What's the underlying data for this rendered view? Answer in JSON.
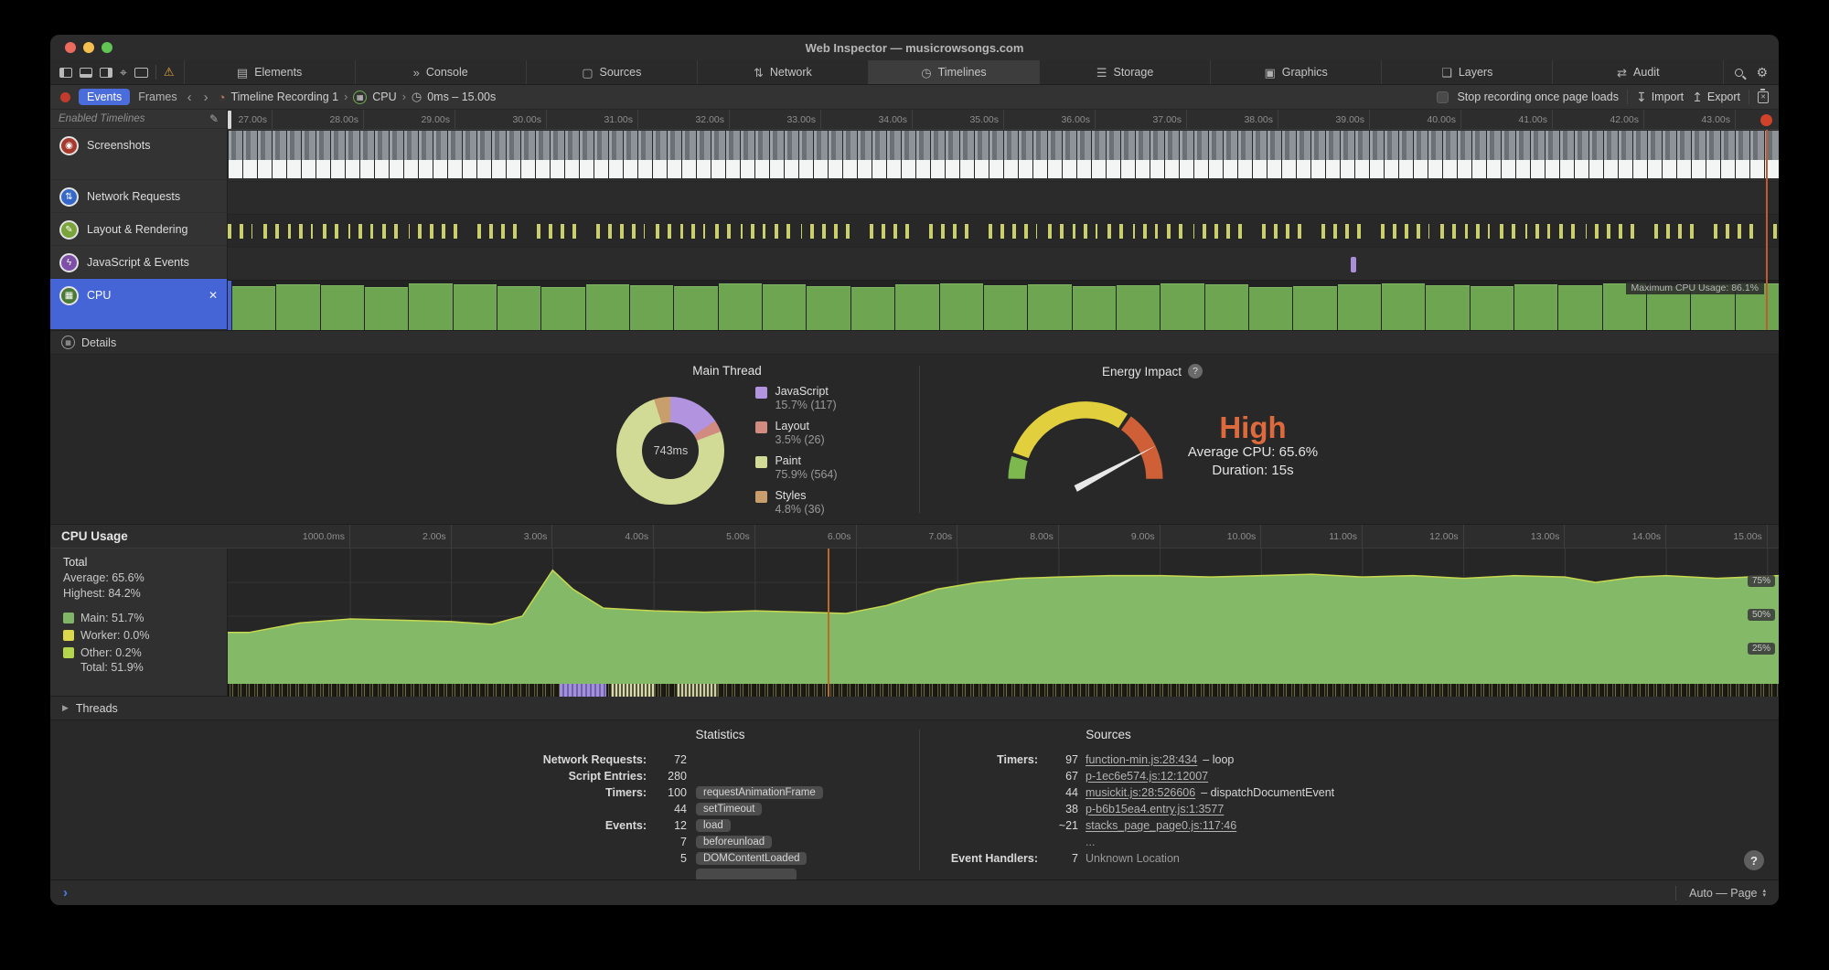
{
  "titlebar": {
    "title": "Web Inspector — musicrowsongs.com"
  },
  "tabbar": {
    "tabs": [
      {
        "label": "Elements",
        "icon": "elements-icon",
        "glyph": "▤",
        "selected": false
      },
      {
        "label": "Console",
        "icon": "console-icon",
        "glyph": "»",
        "selected": false
      },
      {
        "label": "Sources",
        "icon": "sources-icon",
        "glyph": "▢",
        "selected": false
      },
      {
        "label": "Network",
        "icon": "network-icon",
        "glyph": "⇅",
        "selected": false
      },
      {
        "label": "Timelines",
        "icon": "timelines-icon",
        "glyph": "◷",
        "selected": true
      },
      {
        "label": "Storage",
        "icon": "storage-icon",
        "glyph": "☰",
        "selected": false
      },
      {
        "label": "Graphics",
        "icon": "graphics-icon",
        "glyph": "▣",
        "selected": false
      },
      {
        "label": "Layers",
        "icon": "layers-icon",
        "glyph": "❏",
        "selected": false
      },
      {
        "label": "Audit",
        "icon": "audit-icon",
        "glyph": "⇄",
        "selected": false
      }
    ]
  },
  "toolbar": {
    "events_label": "Events",
    "frames_label": "Frames",
    "breadcrumb": [
      {
        "label": "Timeline Recording 1"
      },
      {
        "label": "CPU"
      },
      {
        "label": "0ms – 15.00s"
      }
    ],
    "stop_recording_label": "Stop recording once page loads",
    "import_label": "Import",
    "export_label": "Export"
  },
  "sidebar": {
    "header": "Enabled Timelines",
    "items": [
      {
        "label": "Screenshots",
        "icon": "screenshots-icon",
        "glyph": "◉",
        "color": "#a63a2e",
        "selected": false
      },
      {
        "label": "Network Requests",
        "icon": "network-requests-icon",
        "glyph": "⇅",
        "color": "#3668c9",
        "selected": false
      },
      {
        "label": "Layout & Rendering",
        "icon": "layout-rendering-icon",
        "glyph": "✎",
        "color": "#7ba33c",
        "selected": false
      },
      {
        "label": "JavaScript & Events",
        "icon": "javascript-events-icon",
        "glyph": "ϟ",
        "color": "#7d4fa8",
        "selected": false
      },
      {
        "label": "CPU",
        "icon": "cpu-icon",
        "glyph": "▦",
        "color": "#4a7a35",
        "selected": true
      }
    ]
  },
  "overview": {
    "ruler_labels": [
      "27.00s",
      "28.00s",
      "29.00s",
      "30.00s",
      "31.00s",
      "32.00s",
      "33.00s",
      "34.00s",
      "35.00s",
      "36.00s",
      "37.00s",
      "38.00s",
      "39.00s",
      "40.00s",
      "41.00s",
      "42.00s",
      "43.00s"
    ],
    "max_cpu_label": "Maximum CPU Usage: 86.1%",
    "bar_color": "#6ea551",
    "cpu_bars": [
      90,
      93,
      91,
      88,
      94,
      92,
      89,
      87,
      93,
      91,
      89,
      94,
      93,
      90,
      88,
      92,
      95,
      91,
      93,
      89,
      91,
      94,
      92,
      87,
      89,
      92,
      95,
      91,
      89,
      93,
      91,
      94,
      89,
      92,
      95
    ]
  },
  "details_bar": {
    "label": "Details"
  },
  "main_thread": {
    "title": "Main Thread",
    "center_label": "743ms",
    "segments": [
      {
        "name": "JavaScript",
        "pct": 15.7,
        "label": "15.7% (117)",
        "color": "#b193e0"
      },
      {
        "name": "Layout",
        "pct": 3.5,
        "label": "3.5% (26)",
        "color": "#d18b80"
      },
      {
        "name": "Paint",
        "pct": 75.9,
        "label": "75.9% (564)",
        "color": "#d2db95"
      },
      {
        "name": "Styles",
        "pct": 4.8,
        "label": "4.8% (36)",
        "color": "#c89e6d"
      }
    ]
  },
  "energy": {
    "title": "Energy Impact",
    "rating": "High",
    "average_label": "Average CPU: 65.6%",
    "duration_label": "Duration: 15s",
    "colors": {
      "low": "#7cb84e",
      "medium": "#e2cf3e",
      "high": "#cf5f36",
      "rating_text": "#dd6a3d"
    }
  },
  "cpu_usage": {
    "title": "CPU Usage",
    "ruler_labels": [
      "1000.0ms",
      "2.00s",
      "3.00s",
      "4.00s",
      "5.00s",
      "6.00s",
      "7.00s",
      "8.00s",
      "9.00s",
      "10.00s",
      "11.00s",
      "12.00s",
      "13.00s",
      "14.00s",
      "15.00s"
    ],
    "stats": {
      "total_label": "Total",
      "average": "Average: 65.6%",
      "highest": "Highest: 84.2%",
      "legend": [
        {
          "label": "Main: 51.7%",
          "color": "#80b568"
        },
        {
          "label": "Worker: 0.0%",
          "color": "#ddd74e"
        },
        {
          "label": "Other: 0.2%",
          "color": "#b4d64c"
        }
      ],
      "total": "Total: 51.9%"
    },
    "markers": [
      "75%",
      "50%",
      "25%"
    ],
    "series": {
      "type": "area",
      "fill_color": "#84b968",
      "line_color": "#c8d84f",
      "ylim": [
        0,
        100
      ],
      "x": [
        0,
        0.5,
        1.0,
        1.5,
        2.0,
        2.4,
        2.7,
        3.0,
        3.2,
        3.5,
        4.0,
        4.5,
        5.0,
        5.5,
        5.9,
        6.3,
        6.8,
        7.2,
        7.6,
        8.0,
        8.5,
        9.0,
        9.5,
        10.0,
        10.5,
        11.0,
        11.5,
        12.0,
        12.5,
        13.0,
        13.3,
        13.7,
        14.0,
        14.5,
        15.2
      ],
      "y": [
        38,
        45,
        48,
        47,
        46,
        44,
        50,
        84,
        70,
        56,
        54,
        53,
        54,
        53,
        52,
        58,
        70,
        75,
        78,
        79,
        80,
        80,
        79,
        80,
        81,
        79,
        80,
        78,
        80,
        79,
        75,
        79,
        80,
        78,
        80
      ]
    }
  },
  "threads": {
    "label": "Threads"
  },
  "statistics": {
    "title": "Statistics",
    "rows": [
      {
        "label": "Network Requests:",
        "value": "72",
        "chips": []
      },
      {
        "label": "Script Entries:",
        "value": "280",
        "chips": []
      },
      {
        "label": "Timers:",
        "value": "100",
        "chips": [
          "requestAnimationFrame"
        ]
      },
      {
        "label": "",
        "value": "44",
        "chips": [
          "setTimeout"
        ]
      },
      {
        "label": "Events:",
        "value": "12",
        "chips": [
          "load"
        ]
      },
      {
        "label": "",
        "value": "7",
        "chips": [
          "beforeunload"
        ]
      },
      {
        "label": "",
        "value": "5",
        "chips": [
          "DOMContentLoaded"
        ]
      }
    ]
  },
  "sources": {
    "title": "Sources",
    "rows": [
      {
        "label": "Timers:",
        "value": "97",
        "link": "function-min.js:28:434",
        "suffix": "– loop"
      },
      {
        "label": "",
        "value": "67",
        "link": "p-1ec6e574.js:12:12007",
        "suffix": ""
      },
      {
        "label": "",
        "value": "44",
        "link": "musickit.js:28:526606",
        "suffix": "– dispatchDocumentEvent"
      },
      {
        "label": "",
        "value": "38",
        "link": "p-b6b15ea4.entry.js:1:3577",
        "suffix": ""
      },
      {
        "label": "",
        "value": "~21",
        "link": "stacks_page_page0.js:117:46",
        "suffix": ""
      },
      {
        "label": "",
        "value": "",
        "plain": "..."
      },
      {
        "label": "Event Handlers:",
        "value": "7",
        "plain": "Unknown Location"
      }
    ]
  },
  "statusbar": {
    "selector": "Auto — Page"
  }
}
